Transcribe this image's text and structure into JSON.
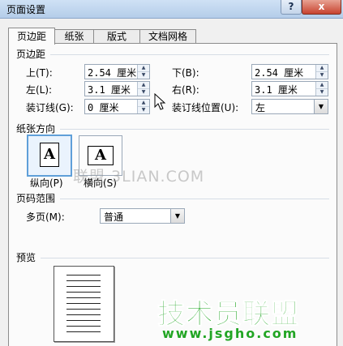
{
  "window": {
    "title": "页面设置",
    "help_label": "?",
    "close_label": "x"
  },
  "tabs": [
    {
      "label": "页边距",
      "active": true
    },
    {
      "label": "纸张",
      "active": false
    },
    {
      "label": "版式",
      "active": false
    },
    {
      "label": "文档网格",
      "active": false
    }
  ],
  "margins": {
    "section_title": "页边距",
    "top": {
      "label": "上(T):",
      "value": "2.54 厘米"
    },
    "bottom": {
      "label": "下(B):",
      "value": "2.54 厘米"
    },
    "left": {
      "label": "左(L):",
      "value": "3.1 厘米"
    },
    "right": {
      "label": "右(R):",
      "value": "3.1 厘米"
    },
    "gutter": {
      "label": "装订线(G):",
      "value": "0 厘米"
    },
    "gutter_position": {
      "label": "装订线位置(U):",
      "value": "左"
    }
  },
  "orientation": {
    "section_title": "纸张方向",
    "portrait": {
      "label": "纵向(P)",
      "selected": true,
      "glyph": "A"
    },
    "landscape": {
      "label": "横向(S)",
      "selected": false,
      "glyph": "A"
    }
  },
  "pages": {
    "section_title": "页码范围",
    "multiple_pages_label": "多页(M):",
    "multiple_pages_value": "普通"
  },
  "preview": {
    "section_title": "预览"
  },
  "watermark_text": "联盟 3LIAN.COM",
  "logo": {
    "text_cn": "技术员联盟",
    "url": "www.jsgho.com",
    "color": "#22a524"
  }
}
